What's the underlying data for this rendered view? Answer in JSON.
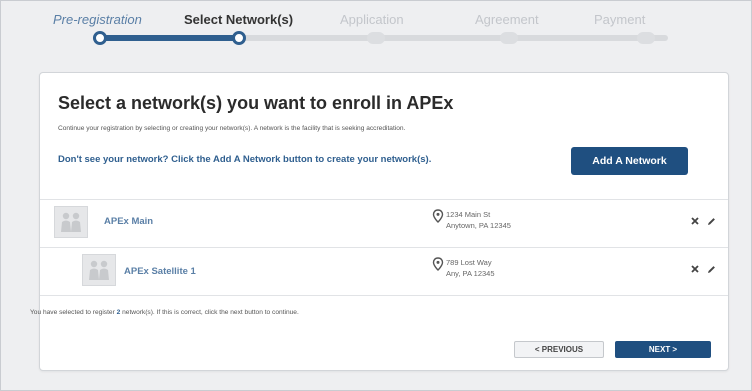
{
  "steps": [
    {
      "label": "Pre-registration",
      "state": "done"
    },
    {
      "label": "Select Network(s)",
      "state": "current"
    },
    {
      "label": "Application",
      "state": "todo"
    },
    {
      "label": "Agreement",
      "state": "todo"
    },
    {
      "label": "Payment",
      "state": "todo"
    }
  ],
  "colors": {
    "accent": "#1f4f80",
    "link": "#2f5f8f",
    "muted": "#c3c6cb"
  },
  "card": {
    "title": "Select a network(s) you want to enroll in APEx",
    "subtitle": "Continue your registration by selecting or creating your network(s). A network is the facility that is seeking accreditation.",
    "prompt": "Don't see your network? Click the Add A Network button to create your network(s).",
    "add_button": "Add A Network"
  },
  "networks": [
    {
      "name": "APEx Main",
      "address_line1": "1234 Main St",
      "address_line2": "Anytown, PA 12345"
    },
    {
      "name": "APEx Satellite 1",
      "address_line1": "789 Lost Way",
      "address_line2": "Any, PA 12345"
    }
  ],
  "summary": {
    "prefix": "You have selected to register ",
    "count": "2",
    "suffix": " network(s). If this is correct, click the next button to continue."
  },
  "nav": {
    "previous": "< PREVIOUS",
    "next": "NEXT >"
  },
  "icons": {
    "network": "people-icon",
    "location": "map-pin-icon",
    "remove": "close-icon",
    "edit": "pencil-icon"
  }
}
